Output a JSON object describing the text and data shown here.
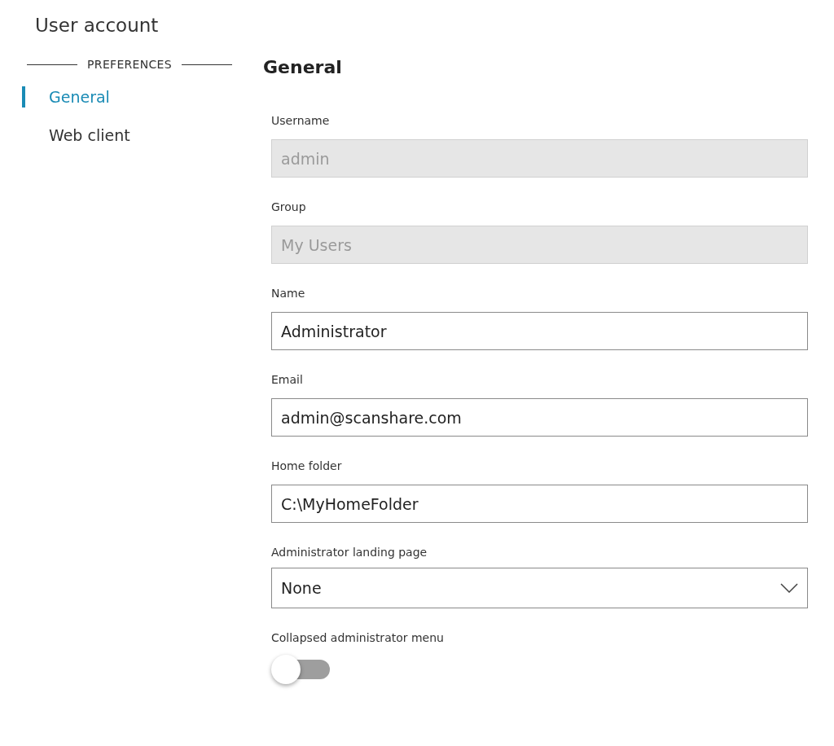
{
  "page": {
    "title": "User account"
  },
  "sidebar": {
    "section": "PREFERENCES",
    "items": [
      {
        "label": "General",
        "selected": true
      },
      {
        "label": "Web client",
        "selected": false
      }
    ]
  },
  "main": {
    "heading": "General",
    "fields": [
      {
        "kind": "text",
        "label": "Username",
        "value": "admin",
        "disabled": true
      },
      {
        "kind": "text",
        "label": "Group",
        "value": "My Users",
        "disabled": true
      },
      {
        "kind": "text",
        "label": "Name",
        "value": "Administrator",
        "disabled": false
      },
      {
        "kind": "text",
        "label": "Email",
        "value": "admin@scanshare.com",
        "disabled": false
      },
      {
        "kind": "text",
        "label": "Home folder",
        "value": "C:\\MyHomeFolder",
        "disabled": false
      },
      {
        "kind": "select",
        "label": "Administrator landing page",
        "value": "None"
      },
      {
        "kind": "toggle",
        "label": "Collapsed administrator menu",
        "on": false
      }
    ]
  }
}
